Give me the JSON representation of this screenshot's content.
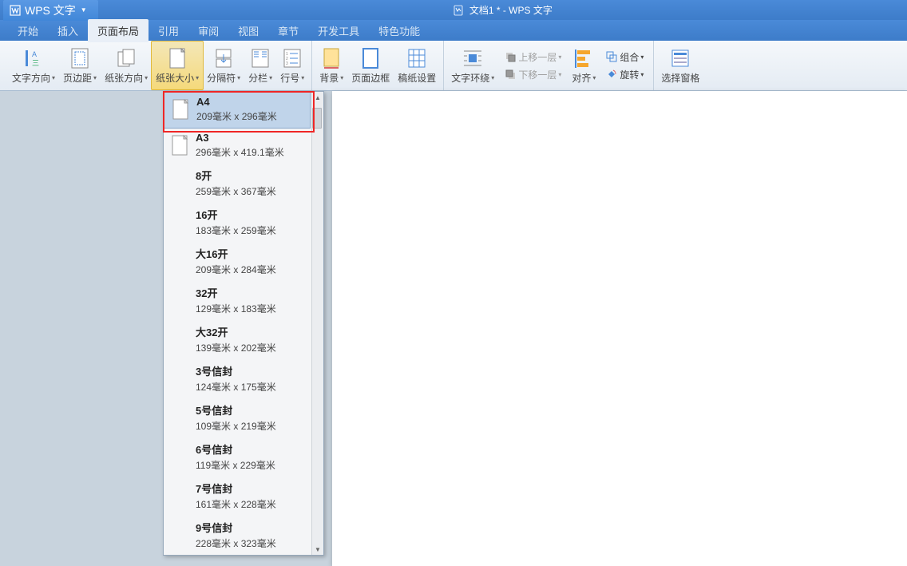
{
  "app": {
    "name": "WPS 文字",
    "doc_title": "文档1 * - WPS 文字"
  },
  "menu": {
    "items": [
      "开始",
      "插入",
      "页面布局",
      "引用",
      "审阅",
      "视图",
      "章节",
      "开发工具",
      "特色功能"
    ],
    "active_index": 2
  },
  "ribbon": {
    "btn_text_dir": "文字方向",
    "btn_margins": "页边距",
    "btn_orient": "纸张方向",
    "btn_size": "纸张大小",
    "btn_breaks": "分隔符",
    "btn_columns": "分栏",
    "btn_lineno": "行号",
    "btn_bg": "背景",
    "btn_border": "页面边框",
    "btn_grid": "稿纸设置",
    "btn_wrap": "文字环绕",
    "btn_up": "上移一层",
    "btn_down": "下移一层",
    "btn_align": "对齐",
    "btn_rotate": "旋转",
    "btn_group": "组合",
    "btn_selpane": "选择窗格"
  },
  "paper_sizes": [
    {
      "name": "A4",
      "dim": "209毫米 x 296毫米",
      "selected": true
    },
    {
      "name": "A3",
      "dim": "296毫米 x 419.1毫米",
      "selected": false
    },
    {
      "name": "8开",
      "dim": "259毫米 x 367毫米",
      "selected": false
    },
    {
      "name": "16开",
      "dim": "183毫米 x 259毫米",
      "selected": false
    },
    {
      "name": "大16开",
      "dim": "209毫米 x 284毫米",
      "selected": false
    },
    {
      "name": "32开",
      "dim": "129毫米 x 183毫米",
      "selected": false
    },
    {
      "name": "大32开",
      "dim": "139毫米 x 202毫米",
      "selected": false
    },
    {
      "name": "3号信封",
      "dim": "124毫米 x 175毫米",
      "selected": false
    },
    {
      "name": "5号信封",
      "dim": "109毫米 x 219毫米",
      "selected": false
    },
    {
      "name": "6号信封",
      "dim": "119毫米 x 229毫米",
      "selected": false
    },
    {
      "name": "7号信封",
      "dim": "161毫米 x 228毫米",
      "selected": false
    },
    {
      "name": "9号信封",
      "dim": "228毫米 x 323毫米",
      "selected": false
    }
  ]
}
